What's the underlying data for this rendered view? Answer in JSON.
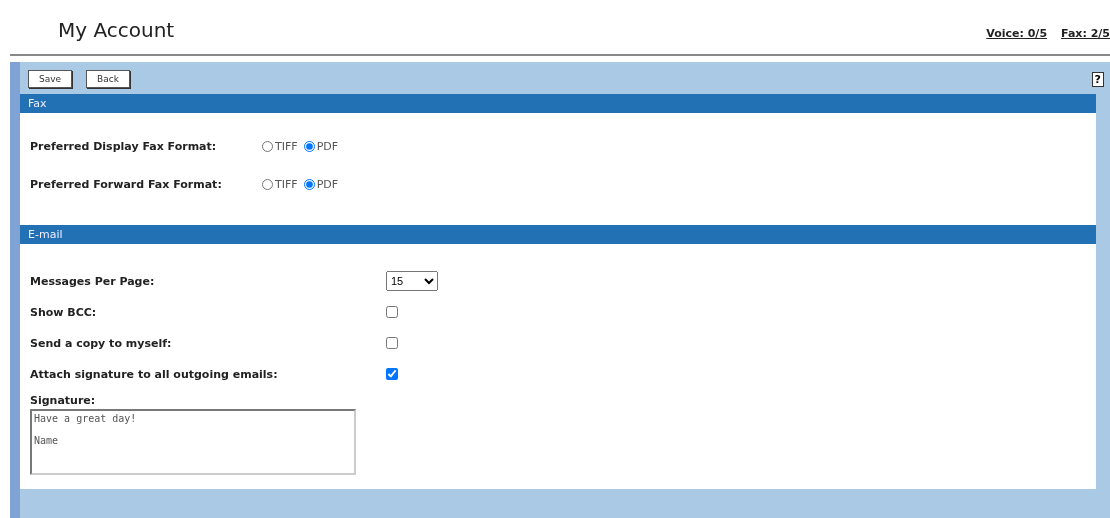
{
  "header": {
    "title": "My Account",
    "links": [
      "Voice: 0/5",
      "Fax: 2/5"
    ]
  },
  "toolbar": {
    "buttons": [
      "Save",
      "Back"
    ],
    "help": "?"
  },
  "sections": [
    {
      "title": "Fax",
      "rows": [
        {
          "kind": "radio",
          "label": "Preferred Display Fax Format:",
          "options": [
            {
              "label": "TIFF",
              "selected": false
            },
            {
              "label": "PDF",
              "selected": true
            }
          ]
        },
        {
          "kind": "radio",
          "label": "Preferred Forward Fax Format:",
          "options": [
            {
              "label": "TIFF",
              "selected": false
            },
            {
              "label": "PDF",
              "selected": true
            }
          ]
        }
      ]
    },
    {
      "title": "E-mail",
      "rows": [
        {
          "kind": "select",
          "label": "Messages Per Page:",
          "value": "15"
        },
        {
          "kind": "checkbox",
          "label": "Show BCC:",
          "checked": false
        },
        {
          "kind": "checkbox",
          "label": "Send a copy to myself:",
          "checked": false
        },
        {
          "kind": "checkbox",
          "label": "Attach signature to all outgoing emails:",
          "checked": true
        },
        {
          "kind": "textarea",
          "label": "Signature:",
          "value": "Have a great day!\n\nName"
        }
      ]
    }
  ]
}
